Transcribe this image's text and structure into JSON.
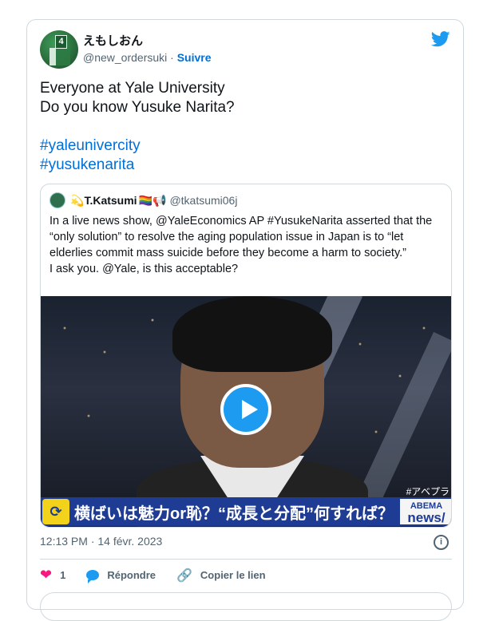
{
  "author": {
    "display_name": "えもしおん",
    "handle": "@new_ordersuki",
    "separator": " · ",
    "follow_label": "Suivre",
    "avatar_badge": "4"
  },
  "tweet": {
    "text": "Everyone at Yale University\nDo you know Yusuke Narita?",
    "hashtags": [
      "#yaleunivercity",
      "#yusukenarita"
    ]
  },
  "quote": {
    "name": "T.Katsumi",
    "name_prefix": "💫",
    "name_suffix": "🏳️‍🌈📢",
    "handle": "@tkatsumi06j",
    "text": "In a live news show, @YaleEconomics AP #YusukeNarita asserted that the “only solution” to resolve the aging population issue in Japan is to “let elderlies commit mass suicide before they become a harm to society.”\nI ask you. @Yale, is this acceptable?",
    "video": {
      "corner_tag": "#アベプラ",
      "caption": "横ばいは魅力or恥？“成長と分配”何すれば？",
      "logo_top": "ABEMA",
      "logo_bottom": "news/"
    }
  },
  "meta": {
    "timestamp": "12:13 PM · 14 févr. 2023"
  },
  "actions": {
    "like_count": "1",
    "reply_label": "Répondre",
    "copy_link_label": "Copier le lien"
  },
  "colors": {
    "link": "#006fd6",
    "brand": "#1d9bf0",
    "like": "#f91880"
  },
  "icons": [
    "twitter-bird-icon",
    "play-icon",
    "info-icon",
    "heart-icon",
    "reply-icon",
    "link-icon"
  ]
}
